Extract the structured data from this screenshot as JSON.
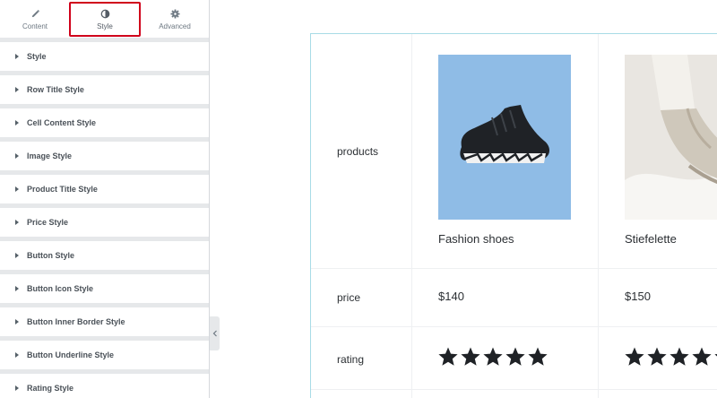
{
  "tabs": [
    {
      "label": "Content",
      "icon": "pencil-icon"
    },
    {
      "label": "Style",
      "icon": "half-circle-icon"
    },
    {
      "label": "Advanced",
      "icon": "gear-icon"
    }
  ],
  "active_tab": "Style",
  "highlight_color": "#d0021b",
  "sections": [
    "Style",
    "Row Title Style",
    "Cell Content Style",
    "Image Style",
    "Product Title Style",
    "Price Style",
    "Button Style",
    "Button Icon Style",
    "Button Inner Border Style",
    "Button Underline Style",
    "Rating Style"
  ],
  "table": {
    "row_labels": {
      "products": "products",
      "price": "price",
      "rating": "rating"
    },
    "products": [
      {
        "title": "Fashion shoes",
        "price": "$140",
        "rating": 5,
        "image_bg": "#8fbce6"
      },
      {
        "title": "Stiefelette",
        "price": "$150",
        "rating": 5,
        "image_bg": "#e9e6e1"
      }
    ]
  }
}
